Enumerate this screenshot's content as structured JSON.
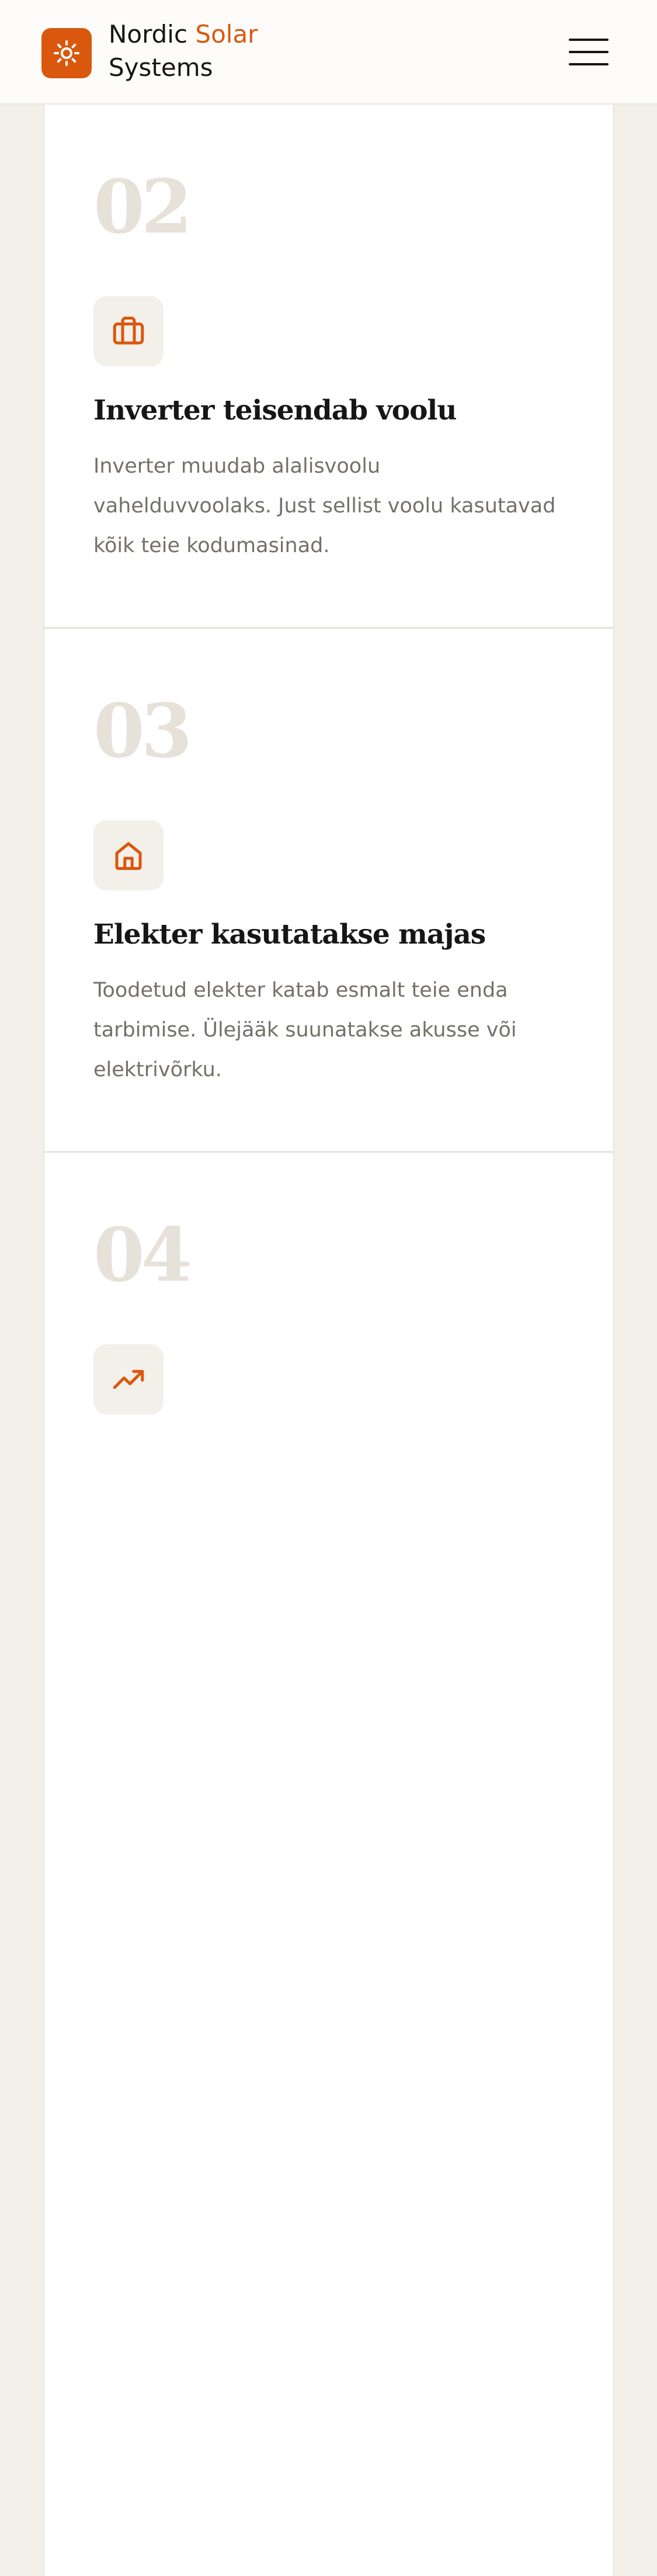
{
  "header": {
    "brand_part1": "Nordic ",
    "brand_accent": "Solar",
    "brand_part2": "Systems",
    "logo_icon": "sun-icon",
    "menu_icon": "hamburger-menu-icon",
    "accent_color": "#d9580e"
  },
  "steps": [
    {
      "number": "02",
      "icon": "briefcase-icon",
      "title": "Inverter teisendab voolu",
      "description": "Inverter muudab alalisvoolu vahelduvvoolaks. Just sellist voolu kasutavad kõik teie kodumasinad."
    },
    {
      "number": "03",
      "icon": "home-icon",
      "title": "Elekter kasutatakse majas",
      "description": "Toodetud elekter katab esmalt teie enda tarbimise. Ülejääk suunatakse akusse või elektrivõrku."
    },
    {
      "number": "04",
      "icon": "trending-up-icon",
      "title": "",
      "description": ""
    }
  ]
}
